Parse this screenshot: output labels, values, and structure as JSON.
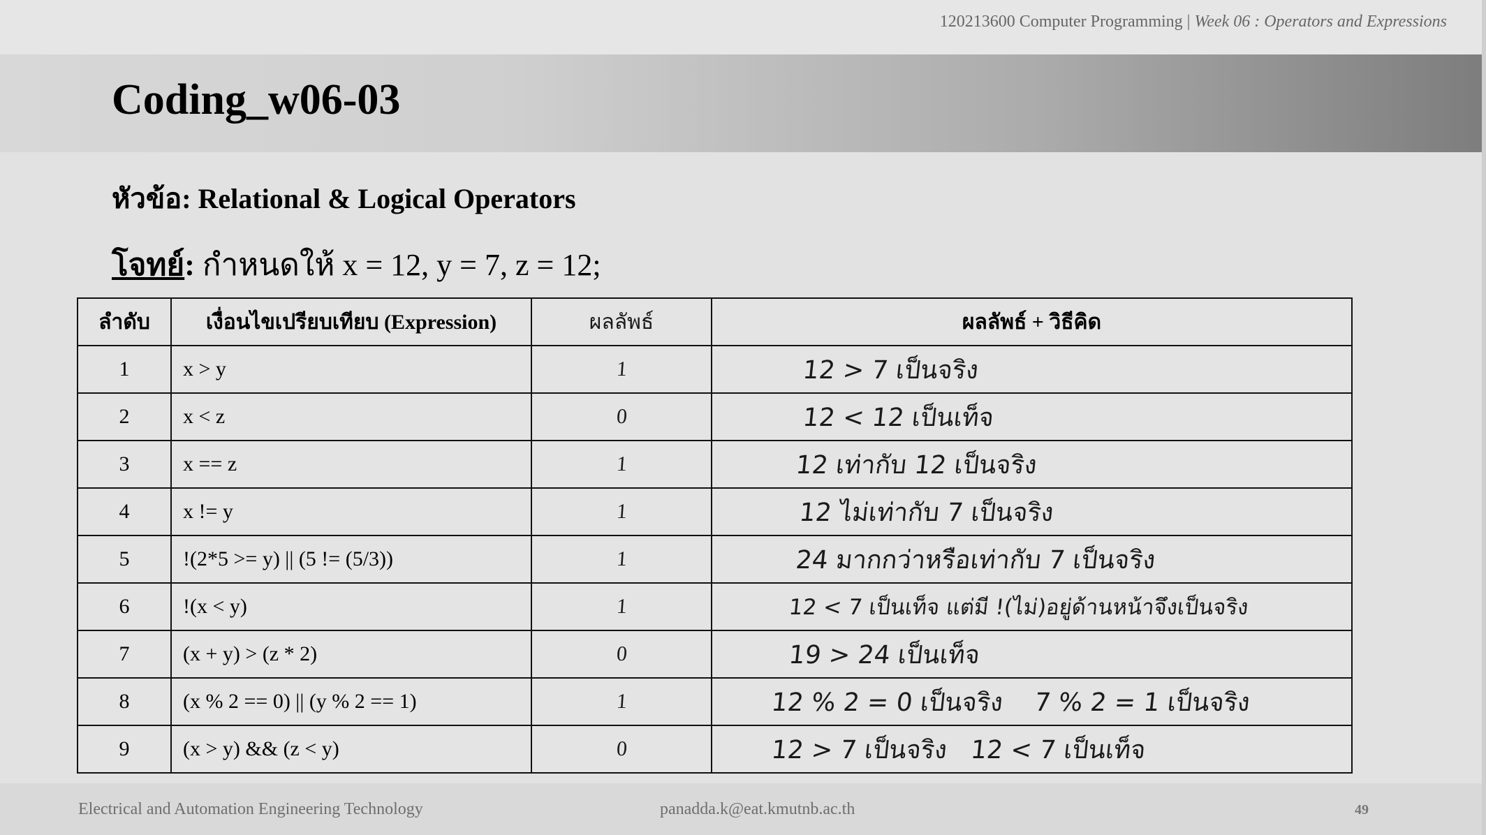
{
  "header": {
    "course": "120213600 Computer Programming",
    "separator": "|",
    "week": "Week 06 : Operators and Expressions"
  },
  "title": "Coding_w06-03",
  "topic": {
    "label": "หัวข้อ:",
    "text": "Relational & Logical Operators"
  },
  "problem": {
    "label": "โจทย์",
    "colon": ":",
    "text": "กำหนดให้ x = 12, y = 7, z = 12;"
  },
  "table": {
    "headers": {
      "no": "ลำดับ",
      "expression": "เงื่อนไขเปรียบเทียบ (Expression)",
      "result": "ผลลัพธ์",
      "explanation": "ผลลัพธ์ + วิธีคิด"
    },
    "rows": [
      {
        "no": "1",
        "expression": "x > y",
        "result": "1",
        "explanation": "12 > 7 เป็นจริง"
      },
      {
        "no": "2",
        "expression": "x < z",
        "result": "0",
        "explanation": "12 < 12 เป็นเท็จ"
      },
      {
        "no": "3",
        "expression": "x == z",
        "result": "1",
        "explanation": "12 เท่ากับ 12 เป็นจริง"
      },
      {
        "no": "4",
        "expression": "x != y",
        "result": "1",
        "explanation": "12 ไม่เท่ากับ 7 เป็นจริง"
      },
      {
        "no": "5",
        "expression": "!(2*5 >= y) || (5 != (5/3))",
        "result": "1",
        "explanation": "24 มากกว่าหรือเท่ากับ 7 เป็นจริง"
      },
      {
        "no": "6",
        "expression": "!(x < y)",
        "result": "1",
        "explanation": "12 < 7 เป็นเท็จ แต่มี !(ไม่)อยู่ด้านหน้าจึงเป็นจริง"
      },
      {
        "no": "7",
        "expression": "(x + y) > (z * 2)",
        "result": "0",
        "explanation": "19 > 24 เป็นเท็จ"
      },
      {
        "no": "8",
        "expression": "(x % 2 == 0) || (y % 2 == 1)",
        "result": "1",
        "explanation": "12 % 2 = 0 เป็นจริง    7 % 2 = 1 เป็นจริง"
      },
      {
        "no": "9",
        "expression": "(x > y) && (z < y)",
        "result": "0",
        "explanation": "12 > 7 เป็นจริง   12 < 7 เป็นเท็จ"
      }
    ]
  },
  "footer": {
    "department": "Electrical and Automation Engineering Technology",
    "email": "panadda.k@eat.kmutnb.ac.th",
    "page": "49"
  }
}
